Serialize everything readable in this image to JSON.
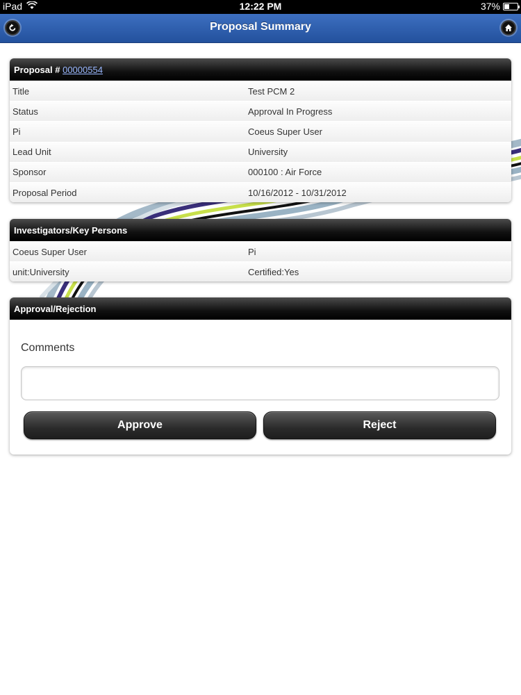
{
  "status_bar": {
    "device": "iPad",
    "time": "12:22 PM",
    "battery": "37%",
    "battery_level": 0.37
  },
  "nav": {
    "title": "Proposal Summary",
    "back_icon": "back-arrow-icon",
    "home_icon": "home-icon"
  },
  "proposal": {
    "header_label": "Proposal #",
    "number": "00000554",
    "rows": [
      {
        "label": "Title",
        "value": "Test PCM 2"
      },
      {
        "label": "Status",
        "value": "Approval In Progress"
      },
      {
        "label": "Pi",
        "value": "Coeus Super User"
      },
      {
        "label": "Lead Unit",
        "value": "University"
      },
      {
        "label": "Sponsor",
        "value": "000100 : Air Force"
      },
      {
        "label": "Proposal Period",
        "value": "10/16/2012 - 10/31/2012"
      }
    ]
  },
  "investigators": {
    "header": "Investigators/Key Persons",
    "rows": [
      {
        "label": "Coeus Super User",
        "value": "Pi"
      },
      {
        "label": "unit:University",
        "value": "Certified:Yes"
      }
    ]
  },
  "approval": {
    "header": "Approval/Rejection",
    "comments_label": "Comments",
    "comments_value": "",
    "approve_label": "Approve",
    "reject_label": "Reject"
  },
  "colors": {
    "nav_blue": "#2c5aa8",
    "header_black": "#111111",
    "accent_green": "#c8e04a",
    "accent_purple": "#3a2f7a"
  }
}
